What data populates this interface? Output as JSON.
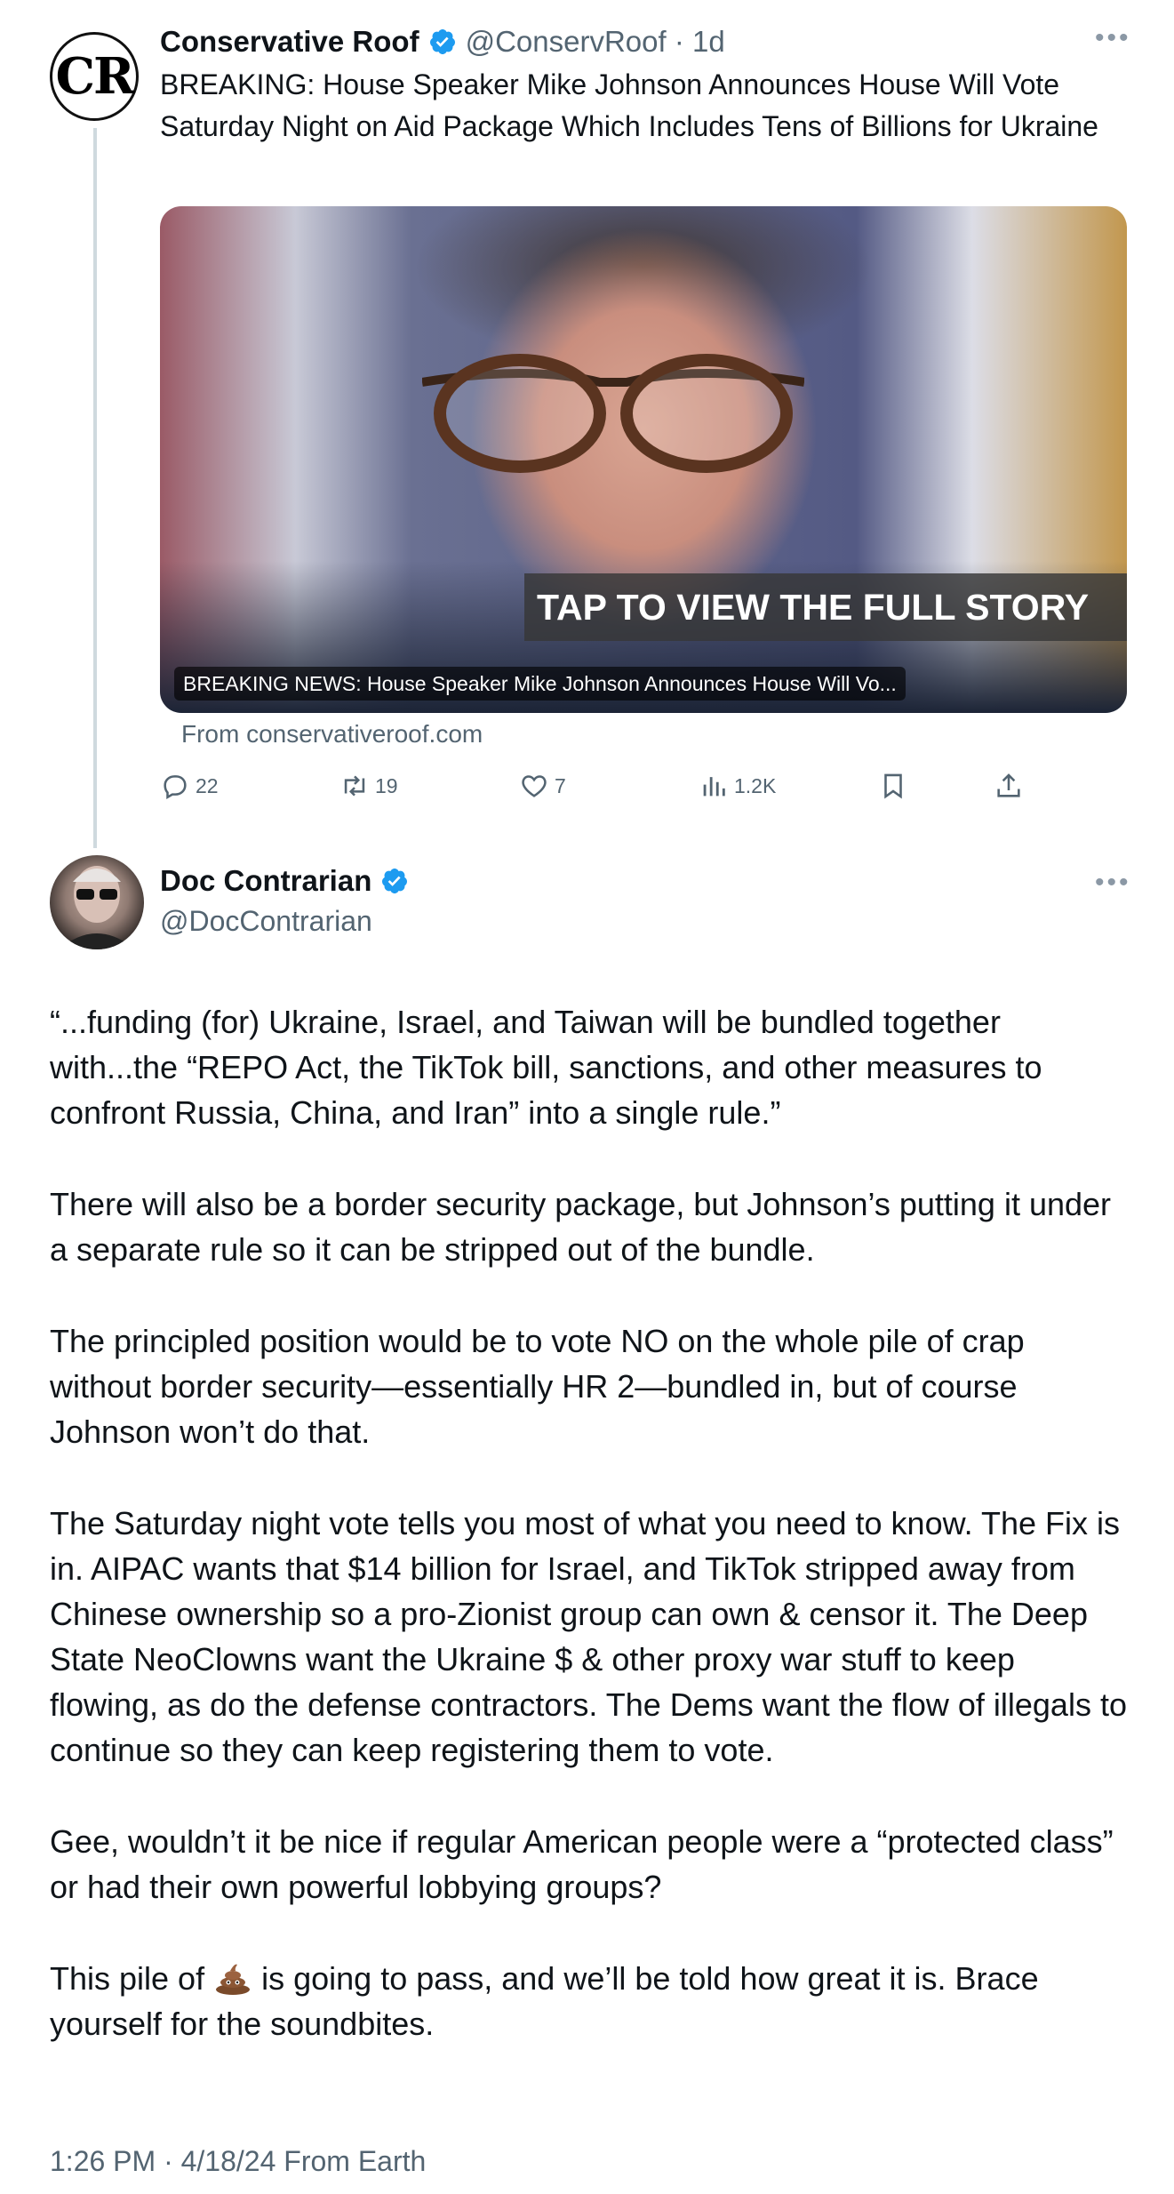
{
  "parent_tweet": {
    "avatar_initials": "CR",
    "author_name": "Conservative Roof",
    "handle_meta": "@ConservRoof · 1d",
    "text": "BREAKING: House Speaker Mike Johnson Announces House Will Vote Saturday Night on Aid Package Which Includes Tens of Billions for Ukraine",
    "card": {
      "banner": "TAP TO VIEW THE FULL STORY",
      "caption": "BREAKING NEWS: House Speaker Mike Johnson Announces House Will Vo...",
      "source": "From conservativeroof.com"
    },
    "actions": {
      "replies": "22",
      "reposts": "19",
      "likes": "7",
      "views": "1.2K"
    }
  },
  "main_tweet": {
    "author_name": "Doc Contrarian",
    "handle": "@DocContrarian",
    "paragraphs": [
      "“...funding (for) Ukraine, Israel, and Taiwan will be bundled together with...the “REPO Act, the TikTok bill, sanctions, and other measures to confront Russia, China, and Iran” into a single rule.”",
      "There will also be a border security package, but Johnson’s putting it under a separate rule so it can be stripped out of the bundle.",
      "The principled position would be to vote NO on the whole pile of crap without border security—essentially HR 2—bundled in, but of course Johnson won’t do that.",
      "The Saturday night vote tells you most of what you need to know. The Fix is in. AIPAC wants that $14 billion for Israel, and TikTok stripped away from Chinese ownership so a pro-Zionist group can own & censor it. The Deep State NeoClowns want the Ukraine $ & other proxy war stuff to keep flowing, as do the defense contractors. The Dems want the flow of illegals to continue so they can keep registering them to vote.",
      "Gee, wouldn’t it be nice if regular American people were a “protected class” or had their own powerful lobbying groups?"
    ],
    "last_paragraph_before": "This pile of",
    "last_paragraph_emoji": "poop-emoji",
    "last_paragraph_after": "is going to pass, and we’ll be told how great it is. Brace yourself for the soundbites.",
    "timestamp": "1:26 PM · 4/18/24 From Earth"
  },
  "colors": {
    "verified_blue": "#1d9bf0",
    "secondary_text": "#536471",
    "thread_line": "#cfd9de"
  }
}
